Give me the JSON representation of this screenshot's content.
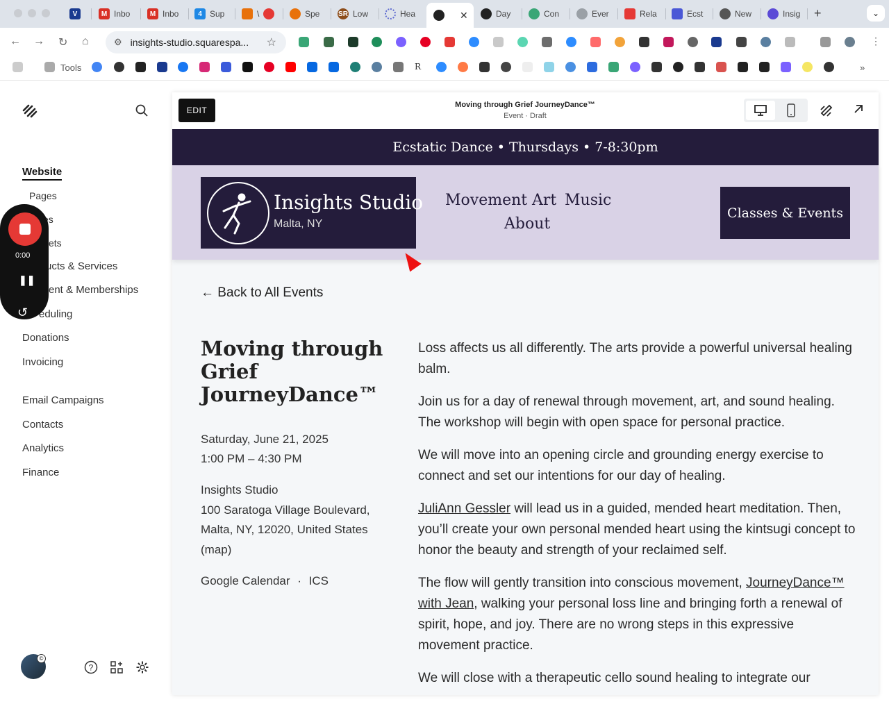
{
  "browser": {
    "tabs": [
      {
        "label": "",
        "color": "#1a3a8f"
      },
      {
        "label": "Inbo",
        "color": "#d93025"
      },
      {
        "label": "Inbo",
        "color": "#d93025"
      },
      {
        "label": "Sup",
        "color": "#1e88e5"
      },
      {
        "label": "\\",
        "color": "#e53935"
      },
      {
        "label": "Spe",
        "color": "#e8710a"
      },
      {
        "label": "Low",
        "color": "#8d4d1a"
      },
      {
        "label": "Hea",
        "color": "#5f6bd0"
      },
      {
        "label": "",
        "color": "#222222"
      },
      {
        "label": "Day",
        "color": "#222222"
      },
      {
        "label": "Con",
        "color": "#3aa676"
      },
      {
        "label": "Ever",
        "color": "#9aa0a6"
      },
      {
        "label": "Rela",
        "color": "#e53935"
      },
      {
        "label": "Ecst",
        "color": "#4a57d6"
      },
      {
        "label": "New",
        "color": "#555555"
      },
      {
        "label": "Insig",
        "color": "#5b4ad6"
      }
    ],
    "active_tab_close": "✕",
    "new_tab": "+",
    "tab_menu": "⌄",
    "url": "insights-studio.squarespa...",
    "bookmarks_folder": "Tools"
  },
  "left_panel": {
    "nav_items": [
      {
        "label": "Website"
      },
      {
        "label": "Pages"
      },
      {
        "label": "es"
      },
      {
        "label": "ets"
      },
      {
        "label": "ucts & Services"
      },
      {
        "label": "ent & Memberships"
      },
      {
        "label": "eduling"
      },
      {
        "label": "Donations"
      },
      {
        "label": "Invoicing"
      },
      {
        "label": "Email Campaigns"
      },
      {
        "label": "Contacts"
      },
      {
        "label": "Analytics"
      },
      {
        "label": "Finance"
      }
    ],
    "recorder_time": "0:00"
  },
  "editor": {
    "edit_label": "EDIT",
    "page_title": "Moving through Grief JourneyDance™",
    "page_status": "Event · Draft"
  },
  "site": {
    "announcement": "Ecstatic Dance • Thursdays • 7-8:30pm",
    "logo_name": "Insights Studio",
    "logo_location": "Malta, NY",
    "nav": [
      "Movement",
      "Art",
      "Music",
      "About"
    ],
    "cta": "Classes & Events"
  },
  "event": {
    "back_link": "← Back to All Events",
    "title": "Moving through Grief JourneyDance™",
    "date": "Saturday, June 21, 2025",
    "time": "1:00 PM – 4:30 PM",
    "venue": "Insights Studio",
    "address_line1": "100 Saratoga Village Boulevard,",
    "address_line2": "Malta, NY, 12020, United States",
    "map_link": "(map)",
    "calendar_google": "Google Calendar",
    "calendar_sep": "·",
    "calendar_ics": "ICS",
    "paragraphs": {
      "p1": "Loss affects us all differently. The arts provide a powerful universal healing balm.",
      "p2": "Join us for a day of renewal through movement, art, and sound healing. The workshop will begin with open space for personal practice.",
      "p3": "We will move into an opening circle and grounding energy exercise to connect and set our intentions for our day of healing.",
      "p4_link": "JuliAnn Gessler",
      "p4_rest": " will lead us in a guided, mended heart meditation. Then, you’ll create your own personal mended heart using the kintsugi concept to honor the beauty and strength of your reclaimed self.",
      "p5_start": "The flow will gently transition into conscious movement, ",
      "p5_link": "JourneyDance™ with Jean",
      "p5_rest": ", walking your personal loss line and bringing forth a renewal of spirit, hope, and joy. There are no wrong steps in this expressive movement practice.",
      "p6": "We will close with a therapeutic cello sound healing to integrate our"
    }
  },
  "colors": {
    "brand_dark": "#241c3b",
    "header_bg": "#d9d2e6",
    "record_red": "#e53935"
  }
}
